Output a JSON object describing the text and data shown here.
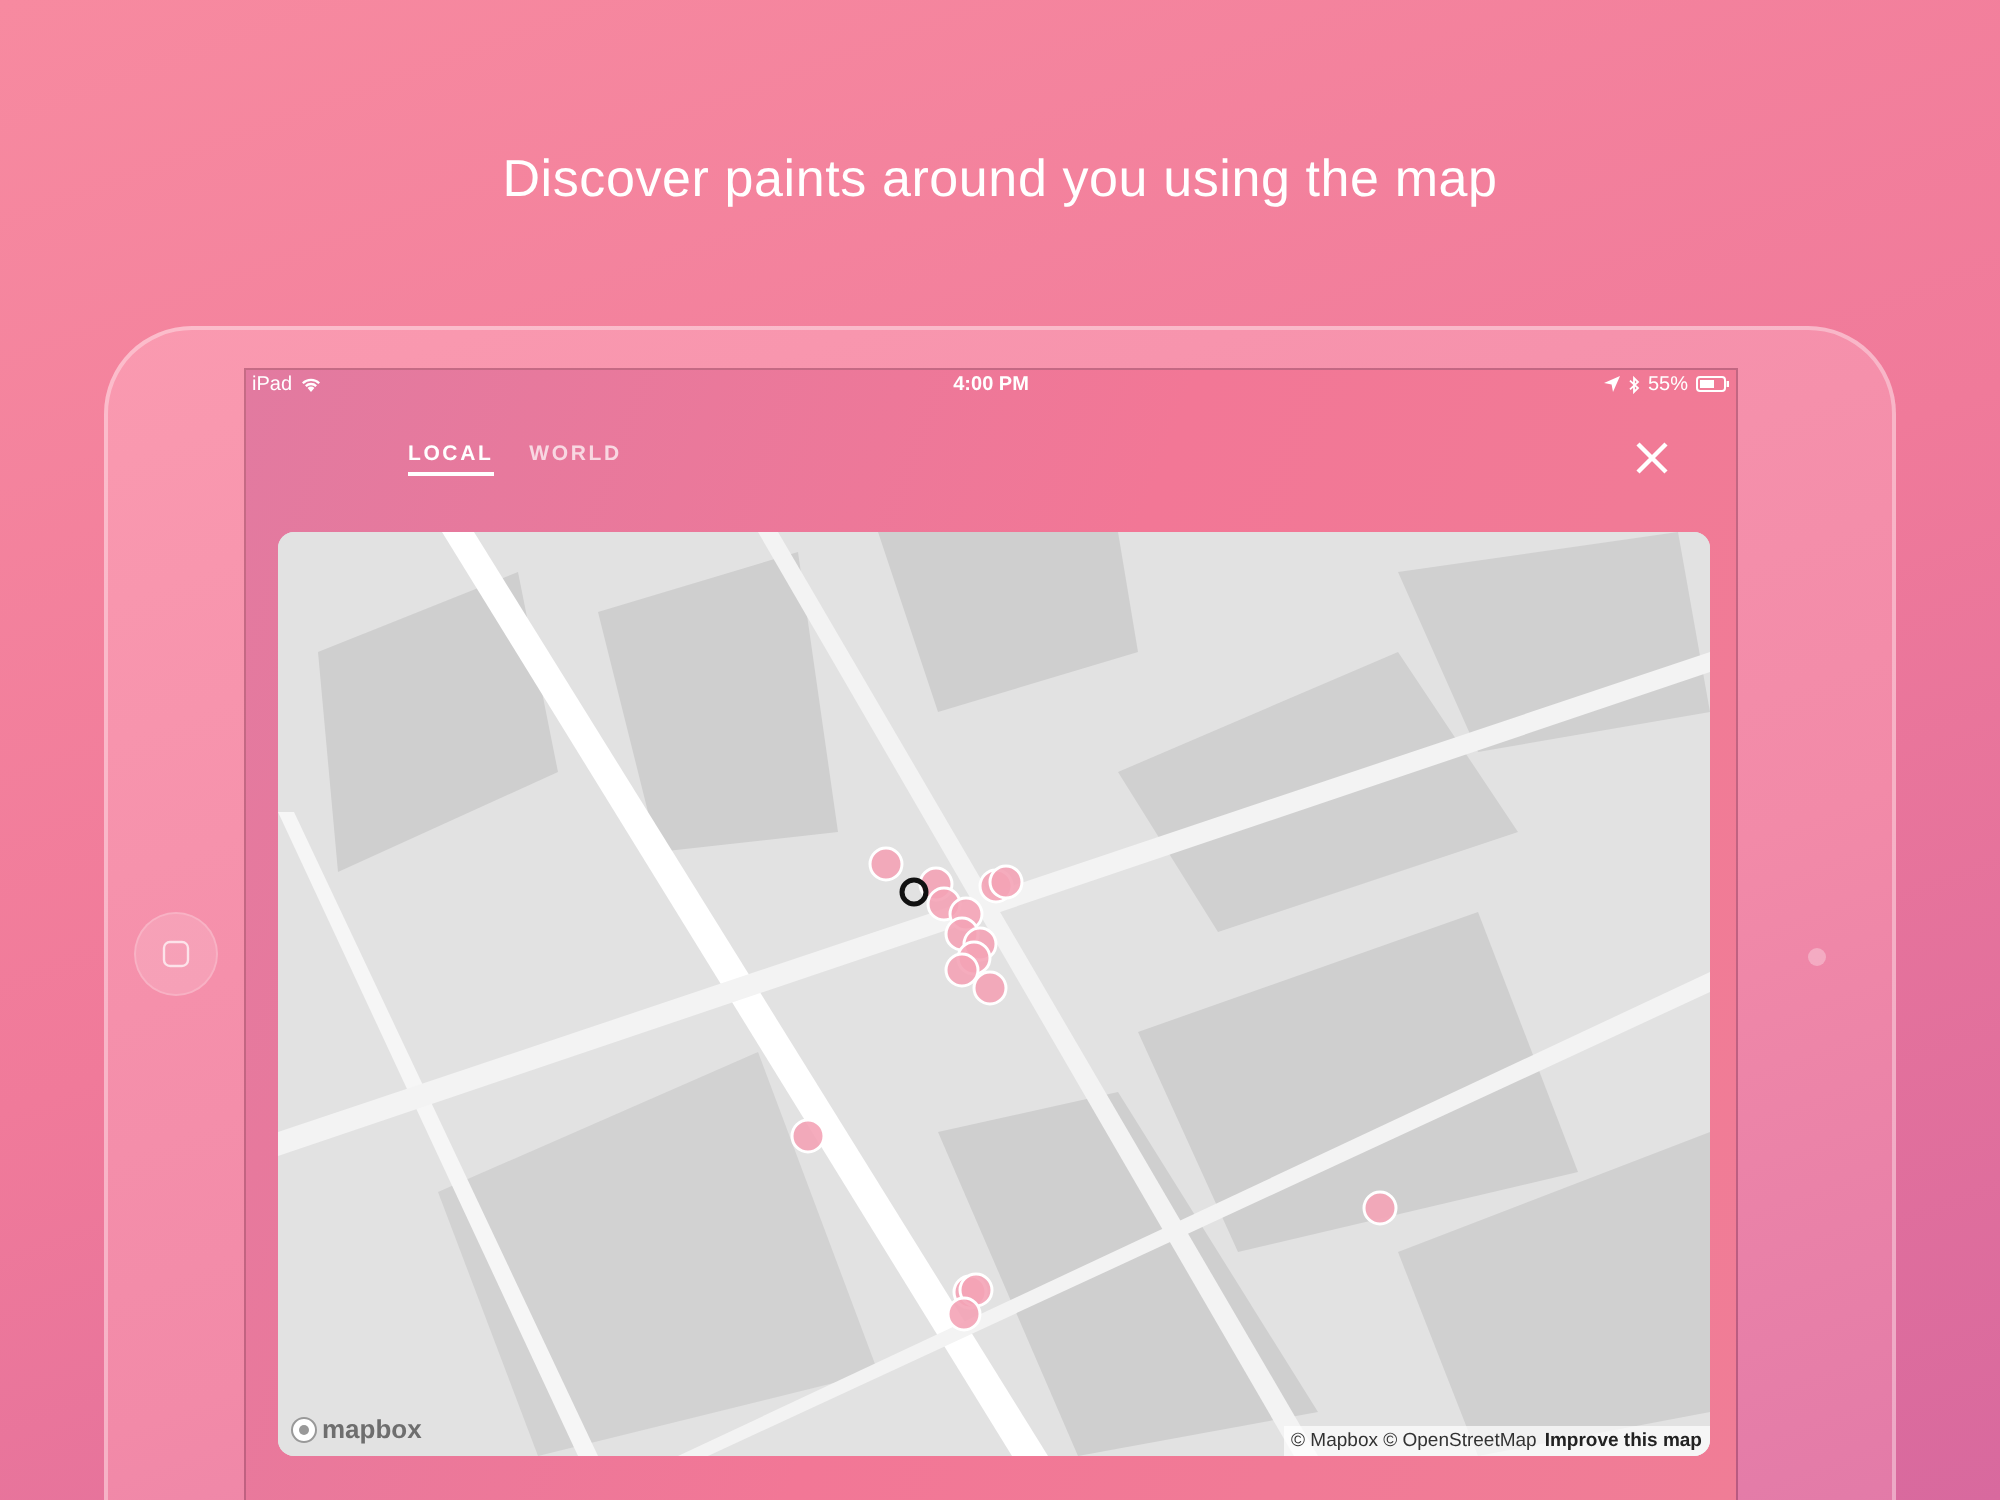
{
  "headline": "Discover paints around you using the map",
  "status_bar": {
    "carrier": "iPad",
    "time": "4:00 PM",
    "battery": "55%"
  },
  "tabs": [
    {
      "label": "LOCAL",
      "selected": true
    },
    {
      "label": "WORLD",
      "selected": false
    }
  ],
  "map": {
    "logo_text": "mapbox",
    "attribution": "© Mapbox © OpenStreetMap",
    "improve_link": "Improve this map"
  }
}
